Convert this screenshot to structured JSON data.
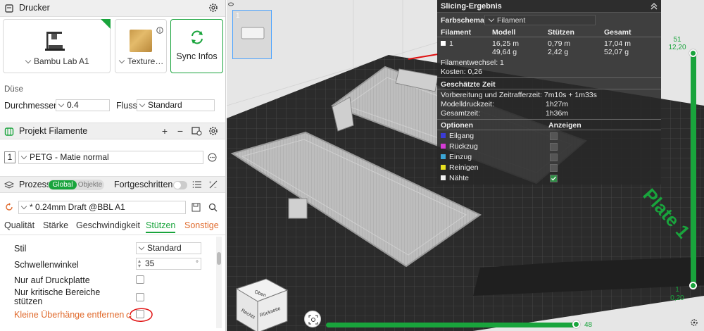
{
  "printer": {
    "title": "Drucker",
    "machine_name": "Bambu Lab A1",
    "plate_name": "Texture…",
    "sync_label": "Sync Infos",
    "nozzle_section": "Düse",
    "diameter_label": "Durchmesser",
    "diameter_value": "0.4",
    "flow_label": "Fluss",
    "flow_value": "Standard"
  },
  "filaments": {
    "title": "Projekt Filamente",
    "items": [
      {
        "index": "1",
        "name": "PETG - Matie normal"
      }
    ]
  },
  "process": {
    "title": "Prozess",
    "toggle_global": "Global",
    "toggle_objects": "Objekte",
    "advanced_label": "Fortgeschritten",
    "profile": "* 0.24mm Draft @BBL A1",
    "tabs": [
      "Qualität",
      "Stärke",
      "Geschwindigkeit",
      "Stützen",
      "Sonstige"
    ],
    "settings": {
      "style_label": "Stil",
      "style_value": "Standard",
      "threshold_label": "Schwellenwinkel",
      "threshold_value": "35",
      "threshold_unit": "°",
      "on_plate_label": "Nur auf Druckplatte",
      "critical_label_1": "Nur kritische Bereiche",
      "critical_label_2": "stützen",
      "remove_small_label": "Kleine Überhänge entfernen"
    }
  },
  "slicing": {
    "title": "Slicing-Ergebnis",
    "color_scheme_label": "Farbschema",
    "color_scheme_value": "Filament",
    "headers": [
      "Filament",
      "Modell",
      "Stützen",
      "Gesamt"
    ],
    "row": {
      "filament": "1",
      "model_len": "16,25 m",
      "model_weight": "49,64 g",
      "support_len": "0,79 m",
      "support_weight": "2,42 g",
      "total_len": "17,04 m",
      "total_weight": "52,07 g"
    },
    "changes": "Filamentwechsel:  1",
    "costs": "Kosten:  0,26",
    "time_title": "Geschätzte Zeit",
    "prep_time": "Vorbereitung und Zeitrafferzeit: 7m10s + 1m33s",
    "model_time_label": "Modelldruckzeit:",
    "model_time_value": "1h27m",
    "total_time_label": "Gesamtzeit:",
    "total_time_value": "1h36m",
    "options_label": "Optionen",
    "show_label": "Anzeigen",
    "options": [
      {
        "name": "Eilgang",
        "color": "#3b3bd6"
      },
      {
        "name": "Rückzug",
        "color": "#d63bd6"
      },
      {
        "name": "Einzug",
        "color": "#3ba6d6"
      },
      {
        "name": "Reinigen",
        "color": "#e8e020"
      },
      {
        "name": "Nähte",
        "color": "#f0f0f0"
      }
    ]
  },
  "viewport": {
    "plate_label": "Plate 1",
    "thumb_number": "1",
    "layer_top": "51",
    "layer_top_height": "12,20",
    "layer_bottom": "1",
    "layer_bottom_height": "0,20",
    "h_value": "48",
    "cube_front": "Rechts",
    "cube_side": "Rückseite",
    "cube_top": "Oben",
    "accent": "#19a43c"
  }
}
